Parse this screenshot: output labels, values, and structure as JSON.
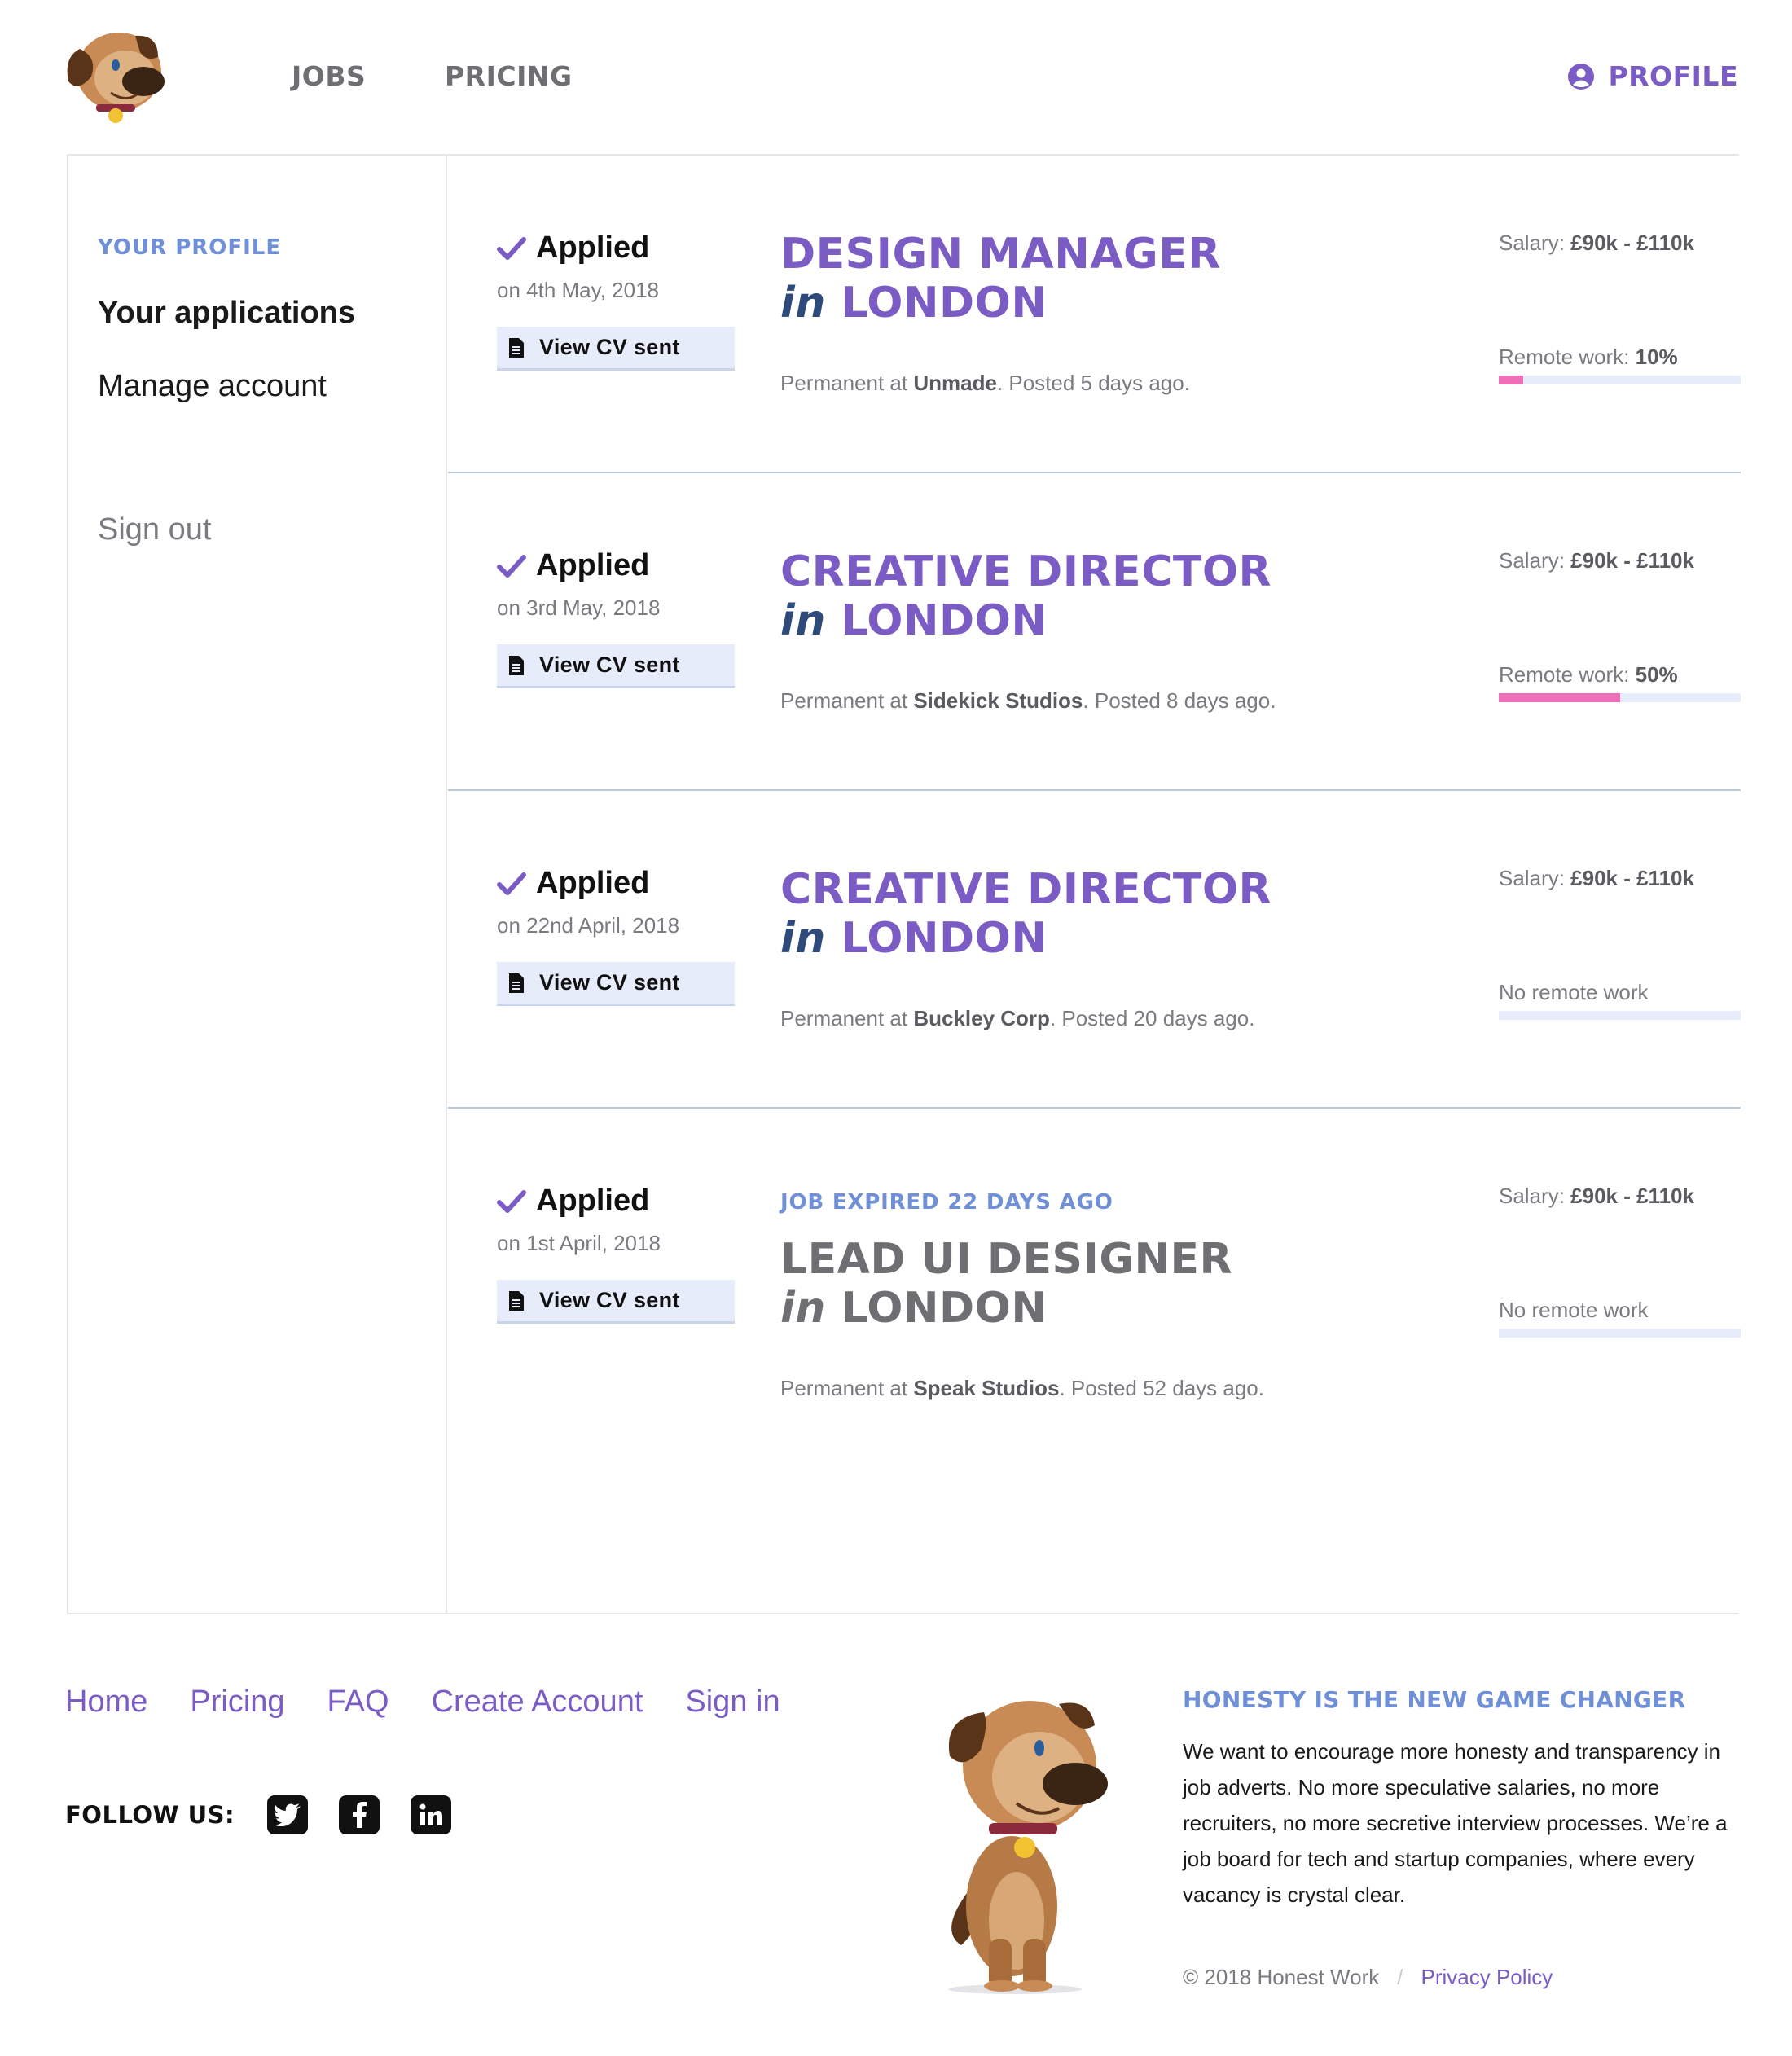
{
  "header": {
    "nav": {
      "jobs": "JOBS",
      "pricing": "PRICING"
    },
    "profile_label": "PROFILE"
  },
  "sidebar": {
    "eyebrow": "YOUR PROFILE",
    "items": [
      "Your applications",
      "Manage account"
    ],
    "sign_out": "Sign out"
  },
  "applications": [
    {
      "status": "Applied",
      "date": "on 4th May, 2018",
      "cv_label": "View CV sent",
      "title": "DESIGN MANAGER",
      "in_word": "in",
      "location": "LONDON",
      "type": "Permanent at",
      "company": "Unmade",
      "posted": ". Posted 5 days ago.",
      "salary_label": "Salary:",
      "salary": "£90k - £110k",
      "remote_label": "Remote work:",
      "remote_value": "10%",
      "remote_fraction": 0.1
    },
    {
      "status": "Applied",
      "date": "on 3rd May, 2018",
      "cv_label": "View CV sent",
      "title": "CREATIVE DIRECTOR",
      "in_word": "in",
      "location": "LONDON",
      "type": "Permanent at",
      "company": "Sidekick Studios",
      "posted": ". Posted 8 days ago.",
      "salary_label": "Salary:",
      "salary": "£90k - £110k",
      "remote_label": "Remote work:",
      "remote_value": "50%",
      "remote_fraction": 0.5
    },
    {
      "status": "Applied",
      "date": "on 22nd April, 2018",
      "cv_label": "View CV sent",
      "title": "CREATIVE DIRECTOR",
      "in_word": "in",
      "location": "LONDON",
      "type": "Permanent at",
      "company": "Buckley Corp",
      "posted": ". Posted 20 days ago.",
      "salary_label": "Salary:",
      "salary": "£90k - £110k",
      "remote_none": "No remote work",
      "remote_fraction": 0
    },
    {
      "status": "Applied",
      "date": "on 1st April, 2018",
      "cv_label": "View CV sent",
      "expired_label": "JOB EXPIRED 22 DAYS AGO",
      "title": "LEAD UI DESIGNER",
      "in_word": "in",
      "location": "LONDON",
      "type": "Permanent at",
      "company": "Speak Studios",
      "posted": ". Posted 52 days ago.",
      "salary_label": "Salary:",
      "salary": "£90k - £110k",
      "remote_none": "No remote work",
      "remote_fraction": 0
    }
  ],
  "footer": {
    "links": [
      "Home",
      "Pricing",
      "FAQ",
      "Create Account",
      "Sign in"
    ],
    "follow_label": "FOLLOW US:",
    "social_icons": [
      "twitter-icon",
      "facebook-icon",
      "linkedin-icon"
    ],
    "tagline_heading": "HONESTY IS THE NEW GAME CHANGER",
    "tagline_body": "We want to encourage more honesty and transparency in job adverts. No more speculative salaries, no more recruiters, no more secretive interview processes. We’re a job board for tech and startup companies, where every vacancy is crystal clear.",
    "copyright": "© 2018 Honest Work",
    "separator": "/",
    "privacy": "Privacy Policy"
  },
  "colors": {
    "brand_purple": "#7b5cc4",
    "accent_blue": "#6f8fd6",
    "remote_pink": "#ee6fb8",
    "cv_bg": "#e7ecfa"
  }
}
